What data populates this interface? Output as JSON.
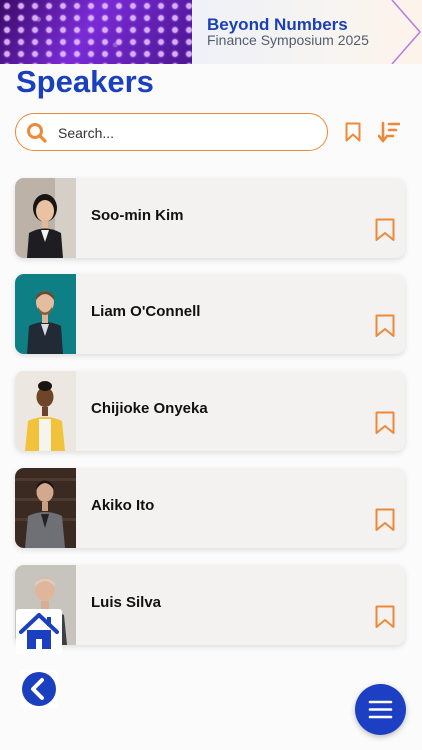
{
  "banner": {
    "title": "Beyond Numbers",
    "subtitle": "Finance Symposium 2025"
  },
  "page": {
    "title": "Speakers"
  },
  "search": {
    "placeholder": "Search..."
  },
  "toolbar": {
    "bookmark_icon": "bookmark-outline-icon",
    "sort_icon": "sort-descending-icon"
  },
  "speakers": [
    {
      "name": "Soo-min Kim"
    },
    {
      "name": "Liam O'Connell"
    },
    {
      "name": "Chijioke Onyeka"
    },
    {
      "name": "Akiko Ito"
    },
    {
      "name": "Luis Silva"
    }
  ],
  "nav": {
    "home_icon": "home-icon",
    "back_icon": "back-chevron-icon",
    "menu_icon": "hamburger-menu-icon"
  },
  "colors": {
    "accent": "#ec8a3a",
    "brand": "#1a3fbf",
    "card_bg": "#f3f2f0"
  }
}
